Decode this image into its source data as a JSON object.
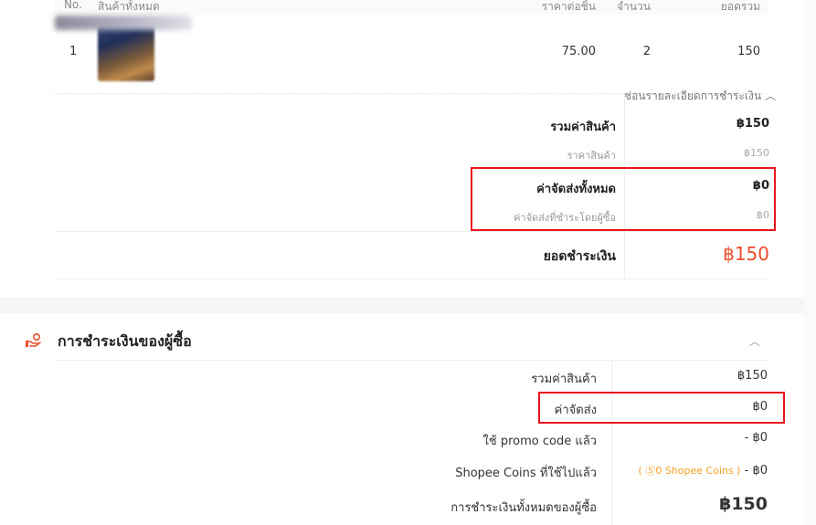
{
  "table": {
    "headers": [
      "No.",
      "สินค้าทั้งหมด",
      "ราคาต่อชิ้น",
      "จำนวน",
      "ยอดรวม"
    ],
    "rows": [
      {
        "no": "1",
        "price": "75.00",
        "qty": "2",
        "subtotal": "150"
      }
    ]
  },
  "order_summary": {
    "toggle_label": "ซ่อนรายละเอียดการชำระเงิน",
    "toggle_icon": "chevron-up-icon",
    "items_total_label": "รวมค่าสินค้า",
    "items_total_value": "฿150",
    "item_price_label": "ราคาสินค้า",
    "item_price_value": "฿150",
    "shipping_total_label": "ค่าจัดส่งทั้งหมด",
    "shipping_total_value": "฿0",
    "shipping_paid_by_buyer_label": "ค่าจัดส่งที่ชำระโดยผู้ซื้อ",
    "shipping_paid_by_buyer_value": "฿0",
    "grand_total_label": "ยอดชำระเงิน",
    "grand_total_value": "฿150"
  },
  "buyer_payment": {
    "title": "การชำระเงินของผู้ซื้อ",
    "title_icon": "hand-coin-icon",
    "collapse_icon": "chevron-up-icon",
    "items_total_label": "รวมค่าสินค้า",
    "items_total_value": "฿150",
    "shipping_label": "ค่าจัดส่ง",
    "shipping_value": "฿0",
    "promo_label": "ใช้ promo code แล้ว",
    "promo_value": "- ฿0",
    "coins_label": "Shopee Coins ที่ใช้ไปแล้ว",
    "coins_note": "( Ⓢ0 Shopee Coins )",
    "coins_value": "- ฿0",
    "total_label": "การชำระเงินทั้งหมดของผู้ซื้อ",
    "total_value": "฿150"
  },
  "colors": {
    "accent": "#ee4d2d",
    "highlight_box": "#e8141e",
    "coins": "#f0a020"
  }
}
